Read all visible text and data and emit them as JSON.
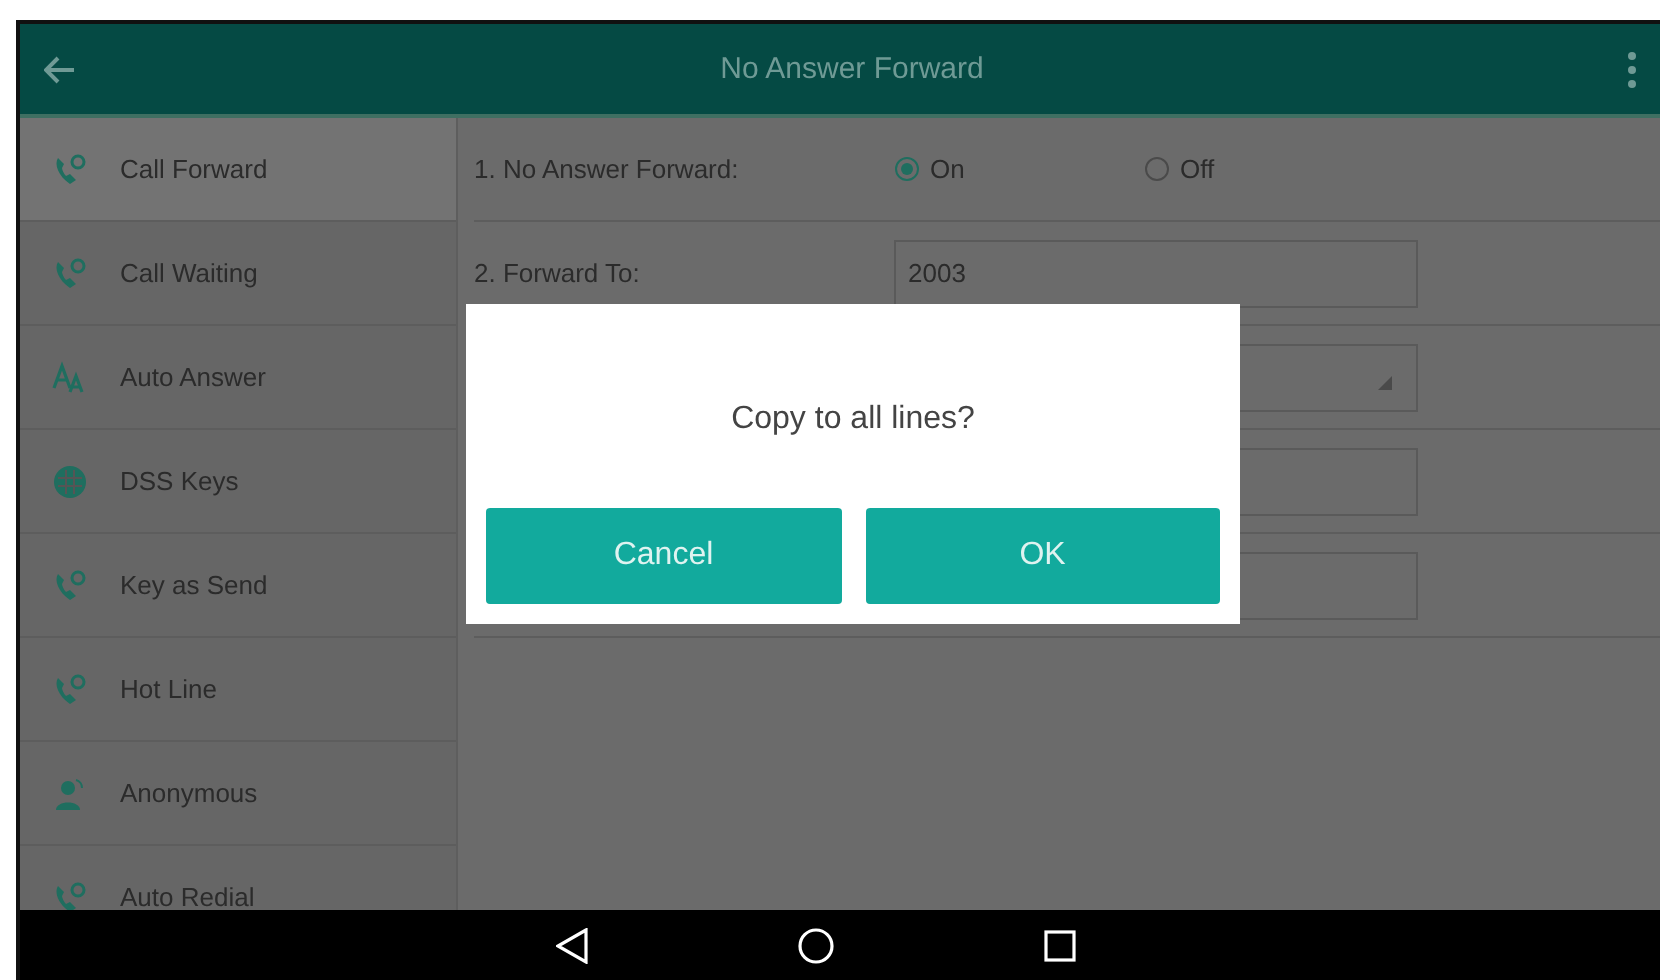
{
  "header": {
    "title": "No Answer Forward"
  },
  "sidebar": {
    "items": [
      {
        "label": "Call Forward",
        "selected": true
      },
      {
        "label": "Call Waiting",
        "selected": false
      },
      {
        "label": "Auto Answer",
        "selected": false
      },
      {
        "label": "DSS Keys",
        "selected": false
      },
      {
        "label": "Key as Send",
        "selected": false
      },
      {
        "label": "Hot Line",
        "selected": false
      },
      {
        "label": "Anonymous",
        "selected": false
      },
      {
        "label": "Auto Redial",
        "selected": false
      }
    ]
  },
  "form": {
    "rows": [
      {
        "kind": "radio",
        "label": "1. No Answer Forward:",
        "options": [
          {
            "label": "On",
            "selected": true
          },
          {
            "label": "Off",
            "selected": false
          }
        ]
      },
      {
        "kind": "field",
        "label": "2. Forward To:",
        "value": "2003"
      },
      {
        "kind": "dropdown"
      },
      {
        "kind": "field"
      },
      {
        "kind": "field"
      }
    ]
  },
  "dialog": {
    "message": "Copy to all lines?",
    "buttons": [
      "Cancel",
      "OK"
    ]
  }
}
